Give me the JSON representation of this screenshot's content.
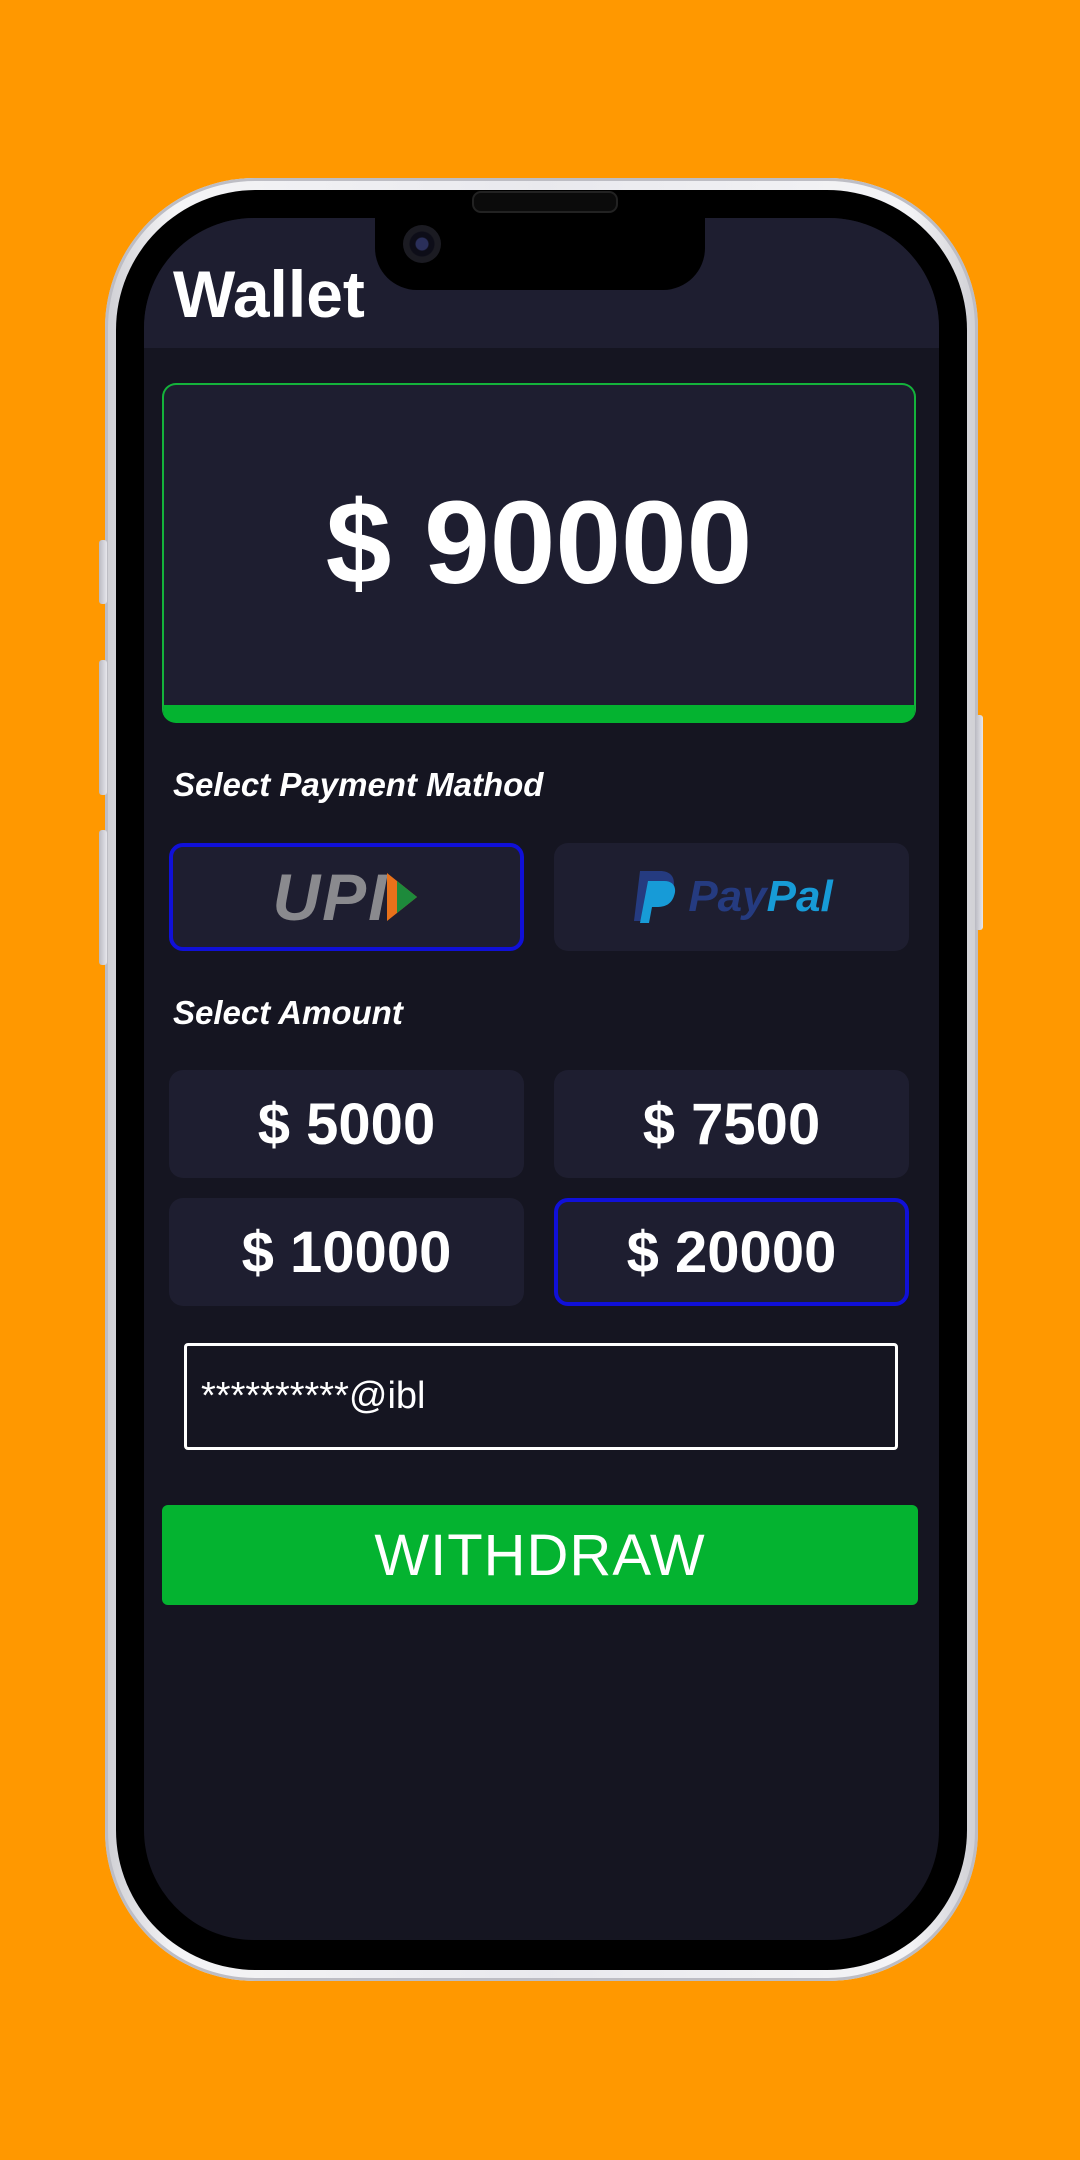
{
  "header": {
    "title": "Wallet"
  },
  "balance": {
    "display": "$ 90000"
  },
  "payment": {
    "label": "Select Payment Mathod",
    "methods": [
      {
        "name": "UPI",
        "selected": true,
        "icon": "upi-logo"
      },
      {
        "name": "PayPal",
        "text_a": "Pay",
        "text_b": "Pal",
        "selected": false,
        "icon": "paypal-logo"
      }
    ]
  },
  "amount": {
    "label": "Select Amount",
    "options": [
      {
        "label": "$ 5000",
        "selected": false
      },
      {
        "label": "$ 7500",
        "selected": false
      },
      {
        "label": "$ 10000",
        "selected": false
      },
      {
        "label": "$ 20000",
        "selected": true
      }
    ]
  },
  "vpa": {
    "value": "**********@ibl"
  },
  "actions": {
    "withdraw_label": "WITHDRAW"
  },
  "colors": {
    "background": "#FF9800",
    "screen": "#151521",
    "card": "#1e1e30",
    "accent_green": "#04b330",
    "selected_border": "#1010d8"
  }
}
